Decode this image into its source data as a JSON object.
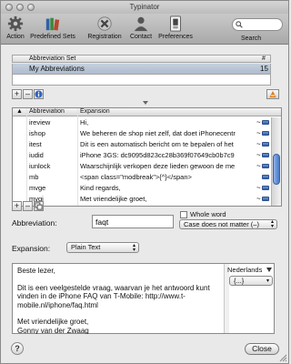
{
  "window": {
    "title": "Typinator"
  },
  "toolbar": {
    "items": [
      {
        "label": "Action",
        "icon": "gear-icon"
      },
      {
        "label": "Predefined Sets",
        "icon": "books-icon"
      },
      {
        "label": "Registration",
        "icon": "cross-icon"
      },
      {
        "label": "Contact",
        "icon": "person-icon"
      },
      {
        "label": "Preferences",
        "icon": "switch-icon"
      }
    ],
    "search_label": "Search",
    "search_value": ""
  },
  "sets": {
    "col_name": "Abbreviation Set",
    "col_count": "#",
    "rows": [
      {
        "name": "My Abbreviations",
        "count": "15"
      }
    ]
  },
  "table": {
    "headers": {
      "abbr": "Abbreviation",
      "exp": "Expansion"
    },
    "sort_arrow": "▲",
    "rows": [
      {
        "abbr": "ireview",
        "exp": "Hi,",
        "tilde": "~",
        "selected": false
      },
      {
        "abbr": "ishop",
        "exp": "We beheren de shop niet zelf, dat doet iPhonecentr",
        "tilde": "~",
        "selected": false
      },
      {
        "abbr": "itest",
        "exp": "Dit is een automatisch bericht om te bepalen of het",
        "tilde": "~",
        "selected": false
      },
      {
        "abbr": "iudid",
        "exp": "iPhone 3GS: dc9095d823cc28b369f07649cb0b7c9",
        "tilde": "~",
        "selected": false
      },
      {
        "abbr": "iunlock",
        "exp": "Waarschijnlijk verkopen deze lieden gewoon de me",
        "tilde": "~",
        "selected": false
      },
      {
        "abbr": "mb",
        "exp": "<span class=\"modbreak\">{^}</span>",
        "tilde": "",
        "selected": false
      },
      {
        "abbr": "mvge",
        "exp": "Kind regards,",
        "tilde": "~",
        "selected": false
      },
      {
        "abbr": "mvgi",
        "exp": "Met vriendelijke groet,",
        "tilde": "~",
        "selected": false
      }
    ]
  },
  "form": {
    "abbreviation_label": "Abbreviation:",
    "abbreviation_value": "faqt",
    "whole_word_label": "Whole word",
    "case_option": "Case does not matter (–)",
    "expansion_label": "Expansion:",
    "expansion_type": "Plain Text",
    "expansion_lines": [
      "Beste lezer,",
      "Dit is een veelgestelde vraag, waarvan je het antwoord kunt vinden in de iPhone FAQ van T-Mobile: http://www.t-mobile.nl/iphone/faq.html",
      "Met vriendelijke groet,\nGonny van der Zwaag"
    ],
    "language": "Nederlands",
    "insert_menu": "{...}"
  },
  "footer": {
    "help": "?",
    "close": "Close"
  }
}
